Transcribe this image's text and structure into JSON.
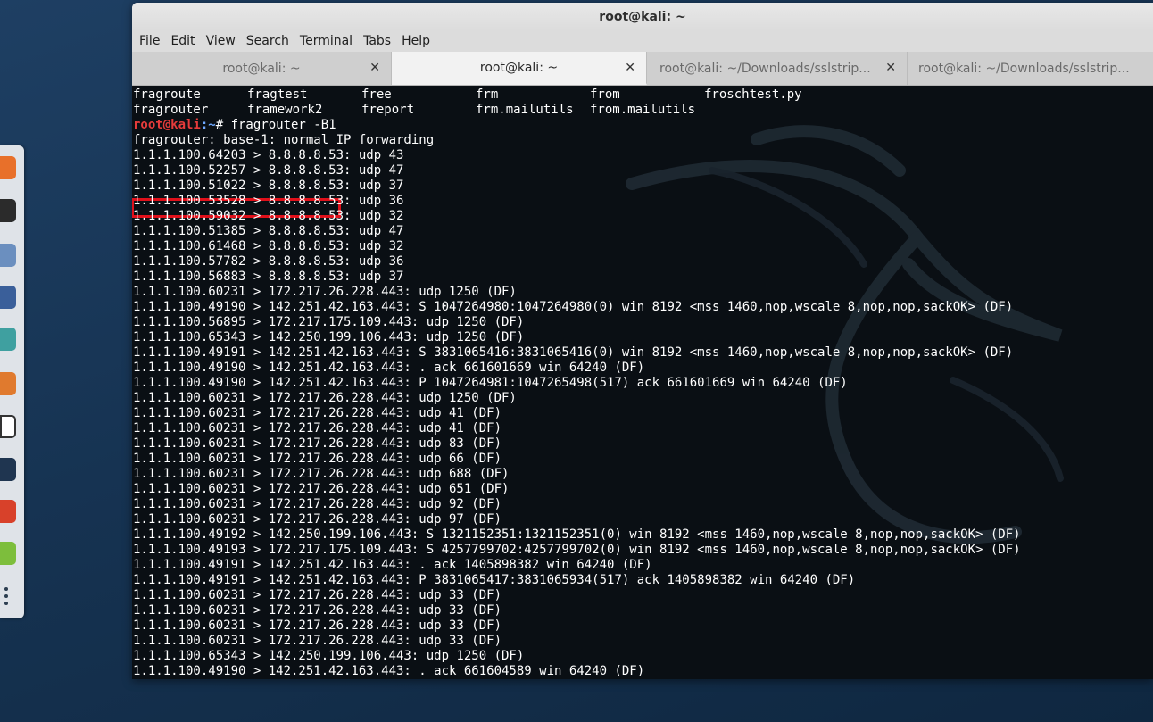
{
  "window": {
    "title": "root@kali: ~"
  },
  "menu": [
    "File",
    "Edit",
    "View",
    "Search",
    "Terminal",
    "Tabs",
    "Help"
  ],
  "tabs": [
    {
      "label": "root@kali: ~",
      "active": false
    },
    {
      "label": "root@kali: ~",
      "active": true
    },
    {
      "label": "root@kali: ~/Downloads/sslstrip...",
      "active": false
    },
    {
      "label": "root@kali: ~/Downloads/sslstrip...",
      "active": false
    }
  ],
  "terminal": {
    "ls_rows": [
      [
        "fragroute",
        "fragtest",
        "free",
        "frm",
        "from",
        "froschtest.py"
      ],
      [
        "fragrouter",
        "framework2",
        "freport",
        "frm.mailutils",
        "from.mailutils",
        ""
      ]
    ],
    "prompt": {
      "user": "root@kali",
      "path": ":~",
      "symbol": "# ",
      "command": "fragrouter -B1"
    },
    "output": [
      "fragrouter: base-1: normal IP forwarding",
      "1.1.1.100.64203 > 8.8.8.8.53: udp 43",
      "1.1.1.100.52257 > 8.8.8.8.53: udp 47",
      "1.1.1.100.51022 > 8.8.8.8.53: udp 37",
      "1.1.1.100.53528 > 8.8.8.8.53: udp 36",
      "1.1.1.100.59032 > 8.8.8.8.53: udp 32",
      "1.1.1.100.51385 > 8.8.8.8.53: udp 47",
      "1.1.1.100.61468 > 8.8.8.8.53: udp 32",
      "1.1.1.100.57782 > 8.8.8.8.53: udp 36",
      "1.1.1.100.56883 > 8.8.8.8.53: udp 37",
      "1.1.1.100.60231 > 172.217.26.228.443: udp 1250 (DF)",
      "1.1.1.100.49190 > 142.251.42.163.443: S 1047264980:1047264980(0) win 8192 <mss 1460,nop,wscale 8,nop,nop,sackOK> (DF)",
      "1.1.1.100.56895 > 172.217.175.109.443: udp 1250 (DF)",
      "1.1.1.100.65343 > 142.250.199.106.443: udp 1250 (DF)",
      "1.1.1.100.49191 > 142.251.42.163.443: S 3831065416:3831065416(0) win 8192 <mss 1460,nop,wscale 8,nop,nop,sackOK> (DF)",
      "1.1.1.100.49190 > 142.251.42.163.443: . ack 661601669 win 64240 (DF)",
      "1.1.1.100.49190 > 142.251.42.163.443: P 1047264981:1047265498(517) ack 661601669 win 64240 (DF)",
      "1.1.1.100.60231 > 172.217.26.228.443: udp 1250 (DF)",
      "1.1.1.100.60231 > 172.217.26.228.443: udp 41 (DF)",
      "1.1.1.100.60231 > 172.217.26.228.443: udp 41 (DF)",
      "1.1.1.100.60231 > 172.217.26.228.443: udp 83 (DF)",
      "1.1.1.100.60231 > 172.217.26.228.443: udp 66 (DF)",
      "1.1.1.100.60231 > 172.217.26.228.443: udp 688 (DF)",
      "1.1.1.100.60231 > 172.217.26.228.443: udp 651 (DF)",
      "1.1.1.100.60231 > 172.217.26.228.443: udp 92 (DF)",
      "1.1.1.100.60231 > 172.217.26.228.443: udp 97 (DF)",
      "1.1.1.100.49192 > 142.250.199.106.443: S 1321152351:1321152351(0) win 8192 <mss 1460,nop,wscale 8,nop,nop,sackOK> (DF)",
      "1.1.1.100.49193 > 172.217.175.109.443: S 4257799702:4257799702(0) win 8192 <mss 1460,nop,wscale 8,nop,nop,sackOK> (DF)",
      "1.1.1.100.49191 > 142.251.42.163.443: . ack 1405898382 win 64240 (DF)",
      "1.1.1.100.49191 > 142.251.42.163.443: P 3831065417:3831065934(517) ack 1405898382 win 64240 (DF)",
      "1.1.1.100.60231 > 172.217.26.228.443: udp 33 (DF)",
      "1.1.1.100.60231 > 172.217.26.228.443: udp 33 (DF)",
      "1.1.1.100.60231 > 172.217.26.228.443: udp 33 (DF)",
      "1.1.1.100.60231 > 172.217.26.228.443: udp 33 (DF)",
      "1.1.1.100.65343 > 142.250.199.106.443: udp 1250 (DF)",
      "1.1.1.100.49190 > 142.251.42.163.443: . ack 661604589 win 64240 (DF)"
    ]
  },
  "colors": {
    "terminal_bg": "#0a0f14",
    "prompt_user": "#e53b3b",
    "prompt_path": "#6ea8ff",
    "highlight": "#e0101a"
  },
  "dock_icons": [
    "firefox-icon",
    "terminal-icon",
    "files-icon",
    "metasploit-icon",
    "maltego-icon",
    "burpsuite-icon",
    "leafpad-icon",
    "cutycapt-icon",
    "beef-icon",
    "notes-icon",
    "app-grid-icon"
  ]
}
